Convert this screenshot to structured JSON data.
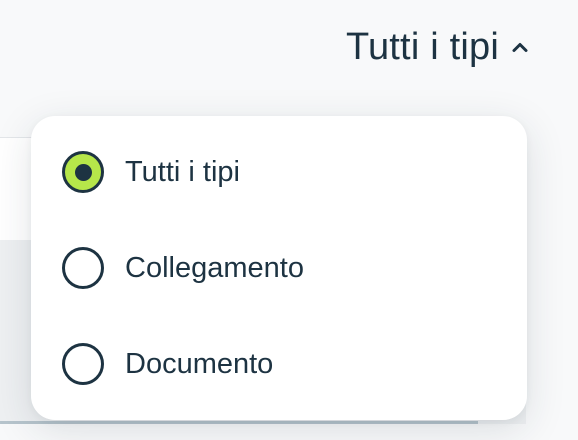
{
  "filter": {
    "selected_label": "Tutti i tipi",
    "expanded": true,
    "chevron_icon": "chevron-up-icon"
  },
  "dropdown": {
    "options": [
      {
        "label": "Tutti i tipi",
        "checked": true
      },
      {
        "label": "Collegamento",
        "checked": false
      },
      {
        "label": "Documento",
        "checked": false
      }
    ]
  },
  "colors": {
    "text": "#1d3342",
    "radio_checked_fill": "#b6e64a",
    "background": "#f8f9fa"
  }
}
